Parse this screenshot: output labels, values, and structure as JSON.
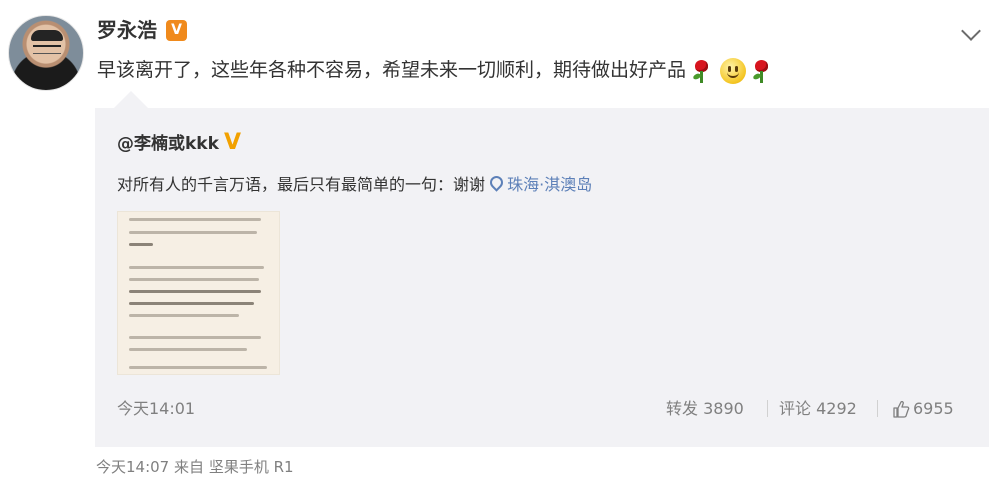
{
  "post": {
    "author": "罗永浩",
    "verified_badge": "V",
    "text": "早该离开了，这些年各种不容易，希望未来一切顺利，期待做出好产品",
    "emojis": [
      "rose-emoji",
      "smile-emoji",
      "rose-emoji"
    ],
    "time": "今天14:07",
    "source_prefix": "来自",
    "source": "坚果手机 R1"
  },
  "repost": {
    "author": "@李楠或kkk",
    "verified_badge": "V",
    "text": "对所有人的千言万语，最后只有最简单的一句：谢谢",
    "location": "珠海·淇澳岛",
    "time": "今天14:01",
    "repost_label": "转发",
    "repost_count": "3890",
    "comment_label": "评论",
    "comment_count": "4292",
    "like_count": "6955"
  },
  "colors": {
    "badge_orange": "#f08a1c",
    "gold_v": "#f2a100",
    "repost_bg": "#f2f2f5",
    "location_blue": "#5d80b8",
    "meta_gray": "#808080"
  }
}
